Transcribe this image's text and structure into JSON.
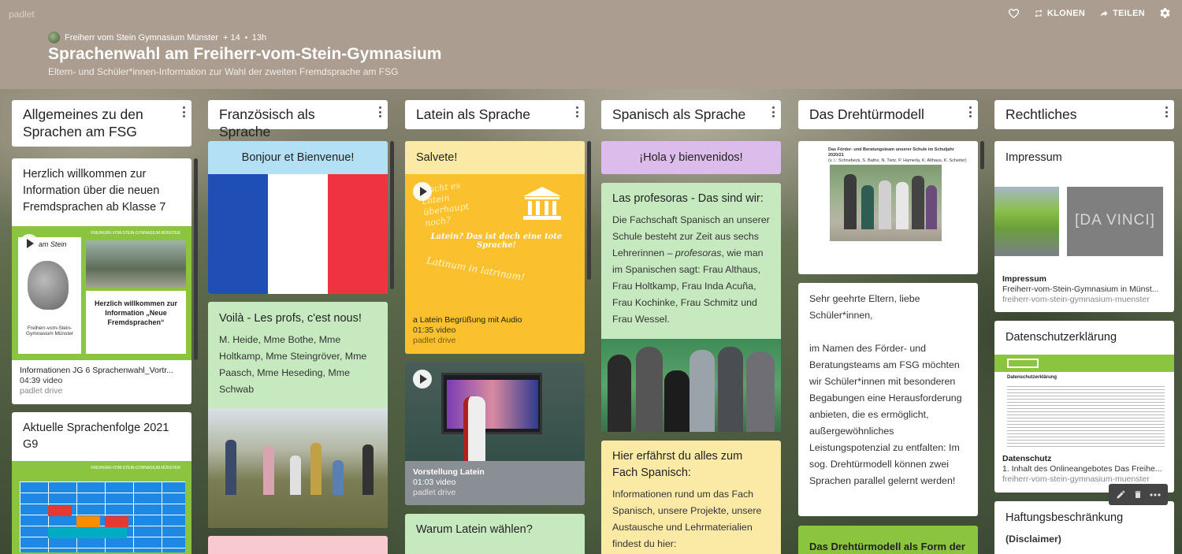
{
  "brand": "padlet",
  "header": {
    "author": "Freiherr vom Stein Gymnasium Münster",
    "likes": "+ 14",
    "age": "13h",
    "title": "Sprachenwahl am Freiherr-vom-Stein-Gymnasium",
    "subtitle": "Eltern- und Schüler*innen-Information zur Wahl der zweiten Fremdsprache am FSG",
    "actions": {
      "clone": "KLONEN",
      "share": "TEILEN"
    }
  },
  "columns": [
    {
      "title": "Allgemeines zu den Sprachen am FSG",
      "cards": [
        {
          "title": "Herzlich willkommen zur Information über die neuen Fremdsprachen ab Klasse 7",
          "thumb": {
            "banner": "FREIHERR-VOM-STEIN-GYMNASIUM MÜNSTER",
            "logo": "Wir am Stein",
            "school": "Freiherr-vom-Stein-Gymnasium Münster",
            "welcome": "Herzlich willkommen zur Information „Neue Fremdsprachen“"
          },
          "attachment": {
            "name": "Informationen JG 6 Sprachenwahl_Vortr...",
            "meta": "04:39 video",
            "source": "padlet drive"
          }
        },
        {
          "title": "Aktuelle Sprachenfolge 2021 G9",
          "thumb": {
            "banner": "FREIHERR-VOM-STEIN-GYMNASIUM MÜNSTER"
          }
        }
      ]
    },
    {
      "title": "Französisch als Sprache",
      "cards": [
        {
          "title": "Bonjour et Bienvenue!"
        },
        {
          "title": "Voilà - Les profs, c'est nous!",
          "body": "M. Heide, Mme Bothe, Mme Holtkamp, Mme Steingröver, Mme Paasch, Mme Heseding, Mme Schwab"
        }
      ]
    },
    {
      "title": "Latein als Sprache",
      "cards": [
        {
          "title": "Salvete!",
          "thumb": {
            "q": "Macht es Latein überhaupt noch?",
            "dead": "Latein? Das ist doch eine tote Sprache!",
            "motto": "Latinum in latrinam!"
          },
          "attachment": {
            "name": "a Latein Begrüßung mit Audio",
            "meta": "01:35 video",
            "source": "padlet drive"
          }
        },
        {
          "attachment": {
            "name": "Vorstellung Latein",
            "meta": "01:03 video",
            "source": "padlet drive"
          }
        },
        {
          "title": "Warum Latein wählen?"
        }
      ]
    },
    {
      "title": "Spanisch als Sprache",
      "cards": [
        {
          "title": "¡Hola y bienvenidos!"
        },
        {
          "title": "Las profesoras - Das sind wir:",
          "body_pre": "Die Fachschaft Spanisch an unserer Schule besteht zur Zeit aus sechs Lehrerinnen – ",
          "body_em": "profesoras",
          "body_post": ", wie man im Spanischen sagt: Frau Althaus, Frau Holtkamp, Frau Inda Acuña, Frau Kochinke, Frau Schmitz und Frau Wessel."
        },
        {
          "title": "Hier erfährst du alles zum Fach Spanisch:",
          "body": "Informationen rund um das Fach Spanisch, unsere Projekte, unsere Austausche und Lehrmaterialien findest du hier:"
        }
      ]
    },
    {
      "title": "Das Drehtürmodell",
      "cards": [
        {
          "caption": "Das Förder- und Beratungsteam unserer Schule im Schuljahr 2020/21",
          "caption_names": "(v. l.: Schnebeck, S. Bathe, N. Tietz, P. Hamerla, K. Althaus, K. Scheiter)"
        },
        {
          "body_a": "Sehr geehrte Eltern, liebe Schüler*innen,",
          "body_b": "im Namen des Förder- und Beratungsteams am FSG möchten wir Schüler*innen mit besonderen Begabungen eine Herausforderung anbieten, die es ermöglicht, außergewöhnliches Leistungspotenzial zu entfalten: Im sog. Drehtürmodell können zwei Sprachen parallel gelernt werden!"
        },
        {
          "title": "Das Drehtürmodell als Form der"
        }
      ]
    },
    {
      "title": "Rechtliches",
      "cards": [
        {
          "title": "Impressum",
          "thumb": {
            "text": "[DA VINCI]"
          },
          "attachment": {
            "name": "Impressum",
            "meta": "Freiherr-vom-Stein-Gymnasium in Münst...",
            "source": "freiherr-vom-stein-gymnasium-muenster"
          }
        },
        {
          "title": "Datenschutzerklärung",
          "thumb": {
            "heading": "Datenschutzerklärung"
          },
          "attachment": {
            "name": "Datenschutz",
            "meta": "1. Inhalt des Onlineangebotes Das Freihe...",
            "source": "freiherr-vom-stein-gymnasium-muenster"
          }
        },
        {
          "title": "Haftungsbeschränkung",
          "body": "(Disclaimer)"
        }
      ]
    }
  ],
  "colors": {
    "header": "#ab9d8f",
    "light_blue": "#b3e0f4",
    "light_green": "#c7e9c0",
    "light_yellow": "#fbeaa6",
    "light_purple": "#dcbcea",
    "pink": "#f8c9cf",
    "gold": "#fbc02d",
    "grey": "#8a8f96"
  }
}
